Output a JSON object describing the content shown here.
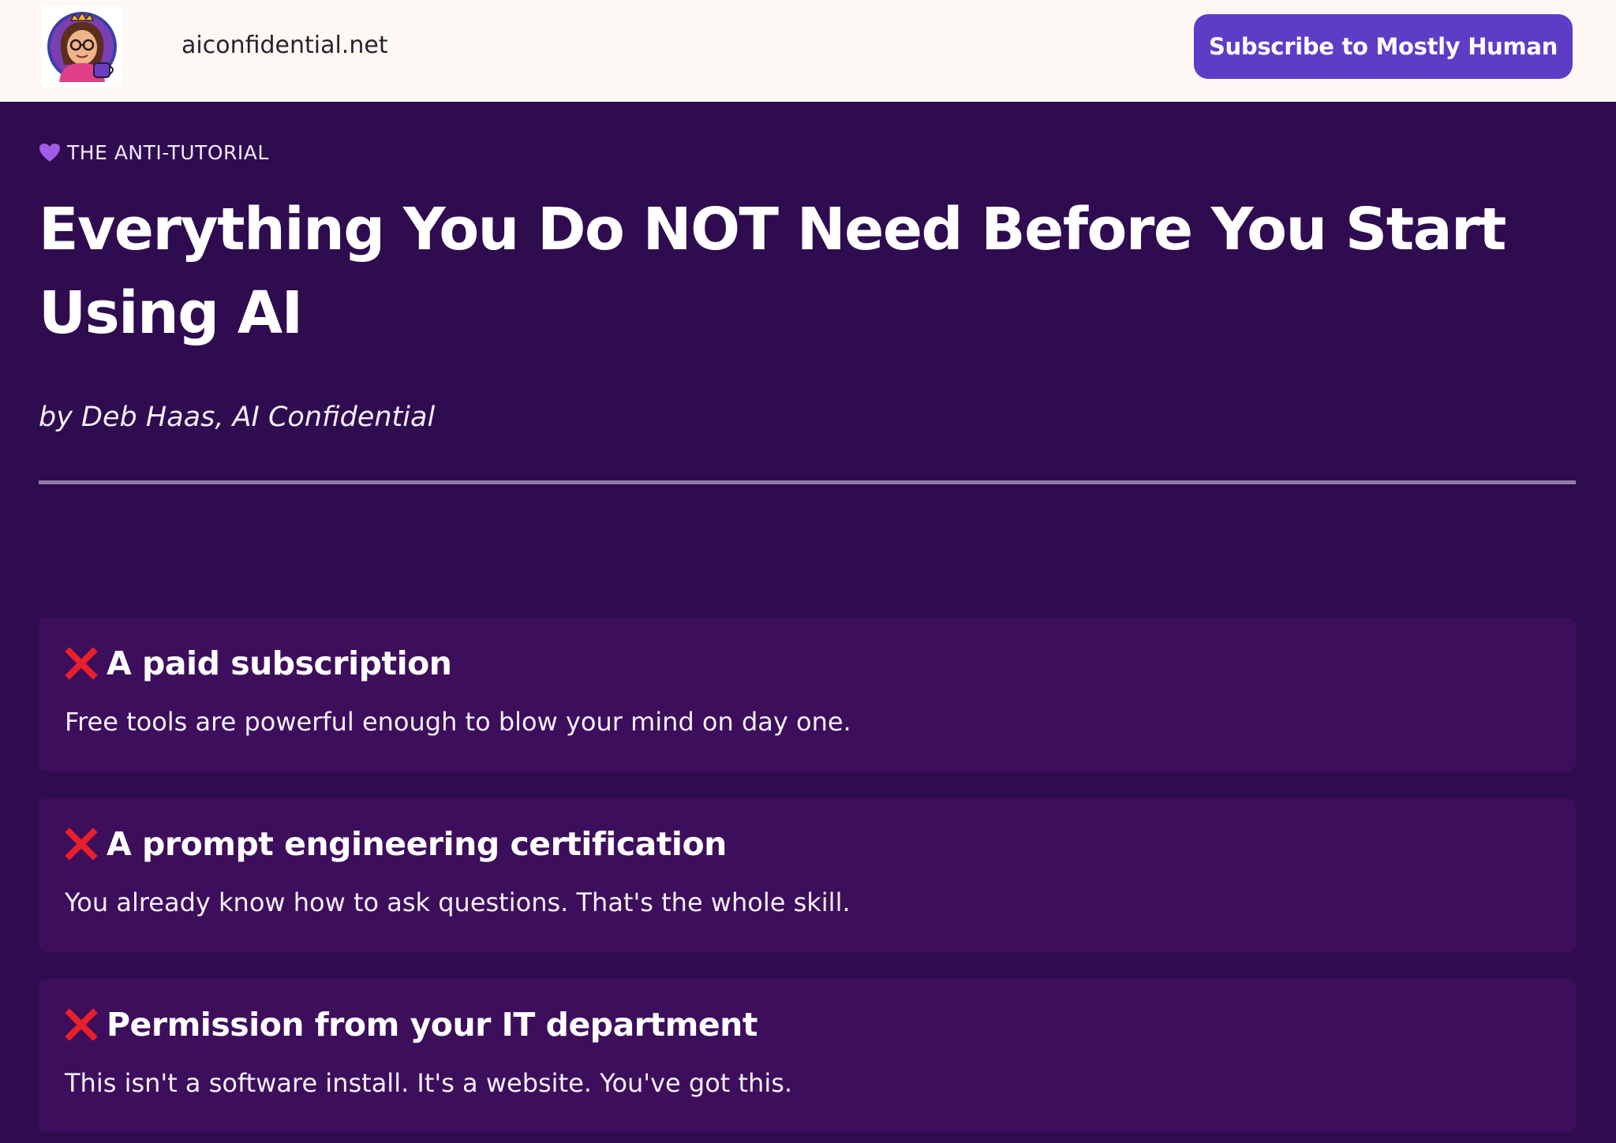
{
  "header": {
    "site_domain": "aiconfidential.net",
    "subscribe_label": "Subscribe to Mostly Human"
  },
  "article": {
    "eyebrow": "THE ANTI-TUTORIAL",
    "title": "Everything You Do NOT Need Before You Start Using AI",
    "byline": "by Deb Haas, AI Confidential",
    "items": [
      {
        "title": "A paid subscription",
        "text": "Free tools are powerful enough to blow your mind on day one."
      },
      {
        "title": "A prompt engineering certification",
        "text": "You already know how to ask questions. That's the whole skill."
      },
      {
        "title": "Permission from your IT department",
        "text": "This isn't a software install. It's a website. You've got this."
      }
    ]
  },
  "colors": {
    "topbar_bg": "#fdf8f3",
    "page_bg": "#2e0c4f",
    "card_bg": "#3d0e5c",
    "button_bg": "#5f3cc6",
    "x_mark": "#e8202a",
    "heart": "#a25ce8"
  },
  "icons": {
    "logo": "avatar-logo-icon",
    "eyebrow": "purple-heart-icon",
    "item_marker": "red-x-icon"
  }
}
